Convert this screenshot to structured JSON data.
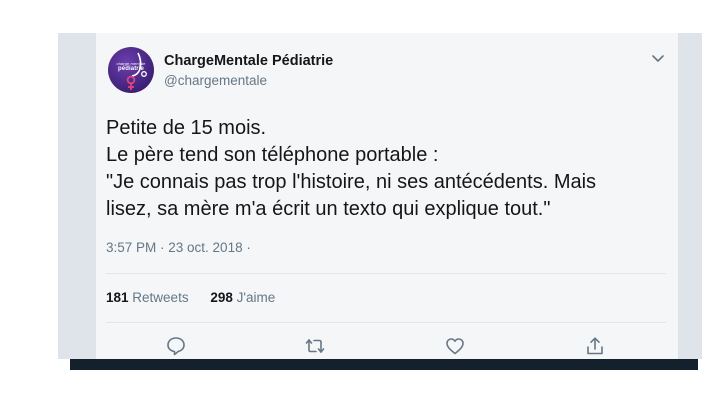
{
  "tweet": {
    "avatar_text": [
      "charge mentale",
      "pédiatrie"
    ],
    "author_name": "ChargeMentale Pédiatrie",
    "author_handle": "@chargementale",
    "lines": [
      "Petite de 15 mois.",
      "Le père tend son téléphone portable :",
      "\"Je connais pas trop l'histoire, ni ses antécédents. Mais",
      "lisez, sa mère m'a écrit un texto qui explique tout.\""
    ],
    "timestamp": "3:57 PM · 23 oct. 2018 ·",
    "retweets_count": "181",
    "retweets_label": "Retweets",
    "likes_count": "298",
    "likes_label": "J'aime"
  },
  "icons": {
    "menu": "chevron-down-icon",
    "reply": "reply-bubble-icon",
    "retweet": "retweet-icon",
    "like": "heart-icon",
    "share": "share-upload-icon"
  },
  "colors": {
    "card_bg": "#f5f6f7",
    "frame_bg": "#dfe3ea",
    "shadow": "#14202b",
    "text": "#14171a",
    "secondary_text": "#657786",
    "avatar_purple": "#3c1f73",
    "avatar_accent": "#e0457b"
  }
}
